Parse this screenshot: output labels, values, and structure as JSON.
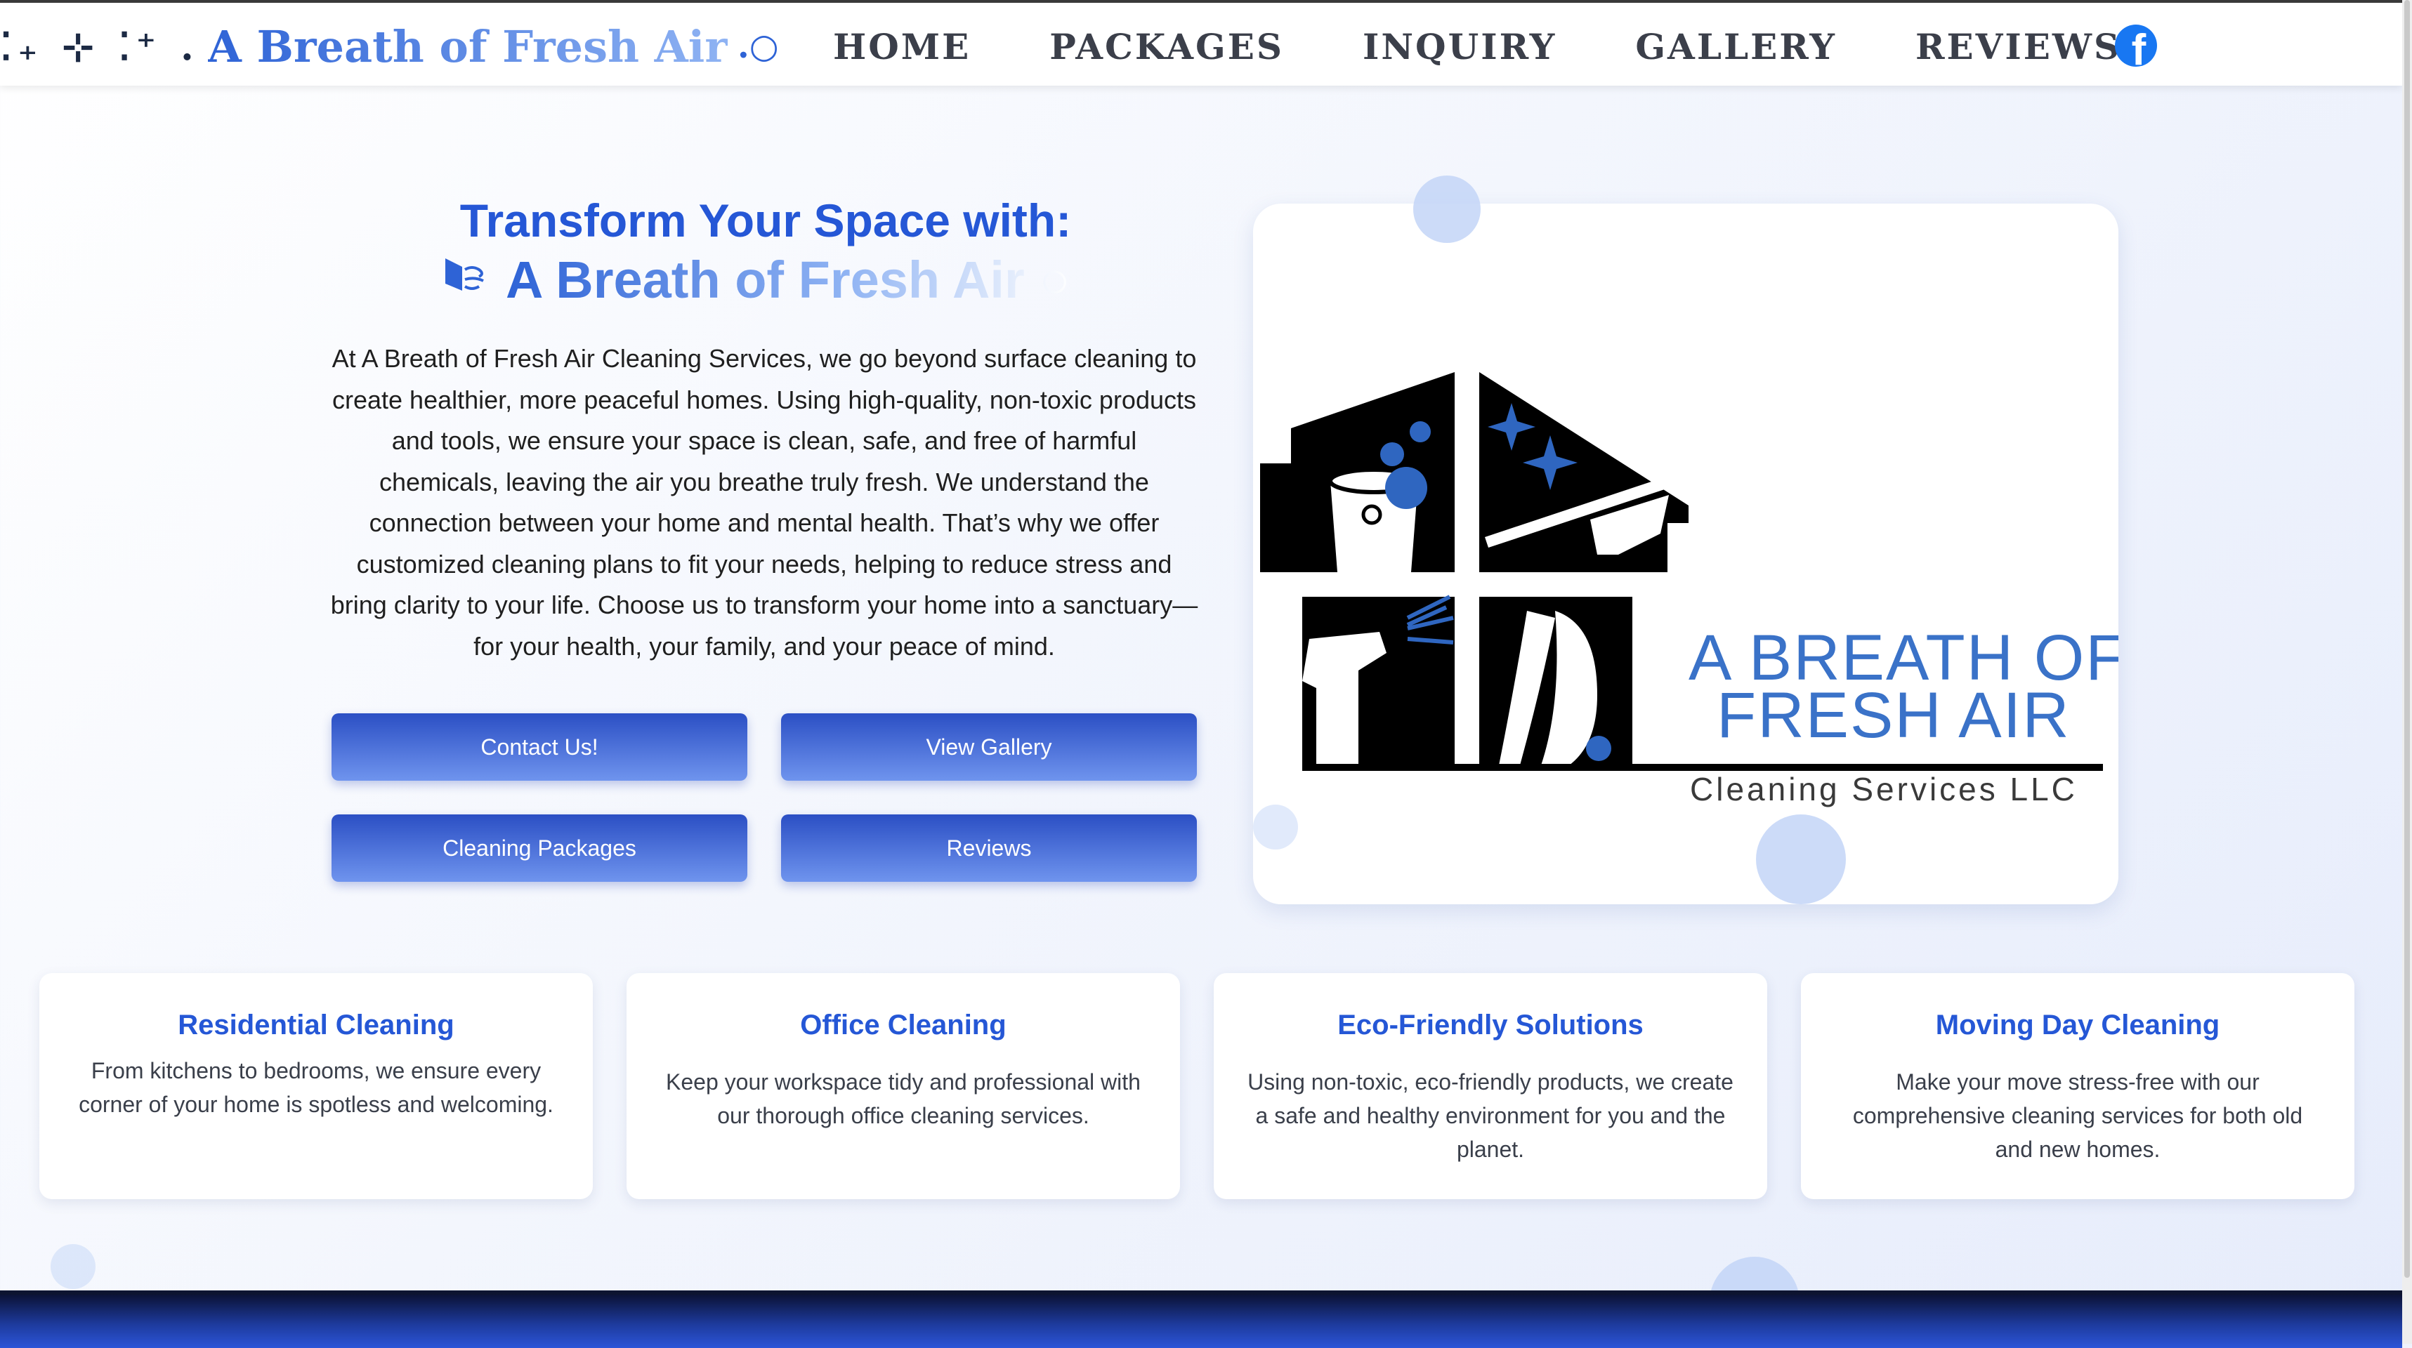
{
  "nav": {
    "brand_sparkles": "⁚₊ ⊹ ⁚⁺ .",
    "brand_name": "A Breath of Fresh Air",
    "brand_tail": ".○",
    "items": [
      {
        "label": "HOME"
      },
      {
        "label": "PACKAGES"
      },
      {
        "label": "INQUIRY"
      },
      {
        "label": "GALLERY"
      },
      {
        "label": "REVIEWS"
      }
    ],
    "social_icon": "facebook-icon"
  },
  "hero": {
    "heading_line1": "Transform Your Space with:",
    "heading_line2": "A Breath of Fresh Air ○",
    "heading_icon": "wind-icon",
    "description": "At A Breath of Fresh Air Cleaning Services, we go beyond surface cleaning to create healthier, more peaceful homes. Using high-quality, non-toxic products and tools, we ensure your space is clean, safe, and free of harmful chemicals, leaving the air you breathe truly fresh. We understand the connection between your home and mental health. That’s why we offer customized cleaning plans to fit your needs, helping to reduce stress and bring clarity to your life. Choose us to transform your home into a sanctuary—for your health, your family, and your peace of mind.",
    "buttons": [
      {
        "label": "Contact Us!"
      },
      {
        "label": "View Gallery"
      },
      {
        "label": "Cleaning Packages"
      },
      {
        "label": "Reviews"
      }
    ]
  },
  "logo": {
    "title_line1": "A BREATH OF",
    "title_line2": "FRESH AIR",
    "subtitle": "Cleaning Services LLC"
  },
  "services": [
    {
      "title": "Residential Cleaning",
      "text": "From kitchens to bedrooms, we ensure every corner of your home is spotless and welcoming."
    },
    {
      "title": "Office Cleaning",
      "text": "Keep your workspace tidy and professional with our thorough office cleaning services."
    },
    {
      "title": "Eco-Friendly Solutions",
      "text": "Using non-toxic, eco-friendly products, we create a safe and healthy environment for you and the planet."
    },
    {
      "title": "Moving Day Cleaning",
      "text": "Make your move stress-free with our comprehensive cleaning services for both old and new homes."
    }
  ],
  "colors": {
    "accent": "#2557d6",
    "button_top": "#2b4fc4",
    "button_bottom": "#6f94ee",
    "logo_blue": "#3a72c8",
    "footer": "#1d3a9c"
  }
}
